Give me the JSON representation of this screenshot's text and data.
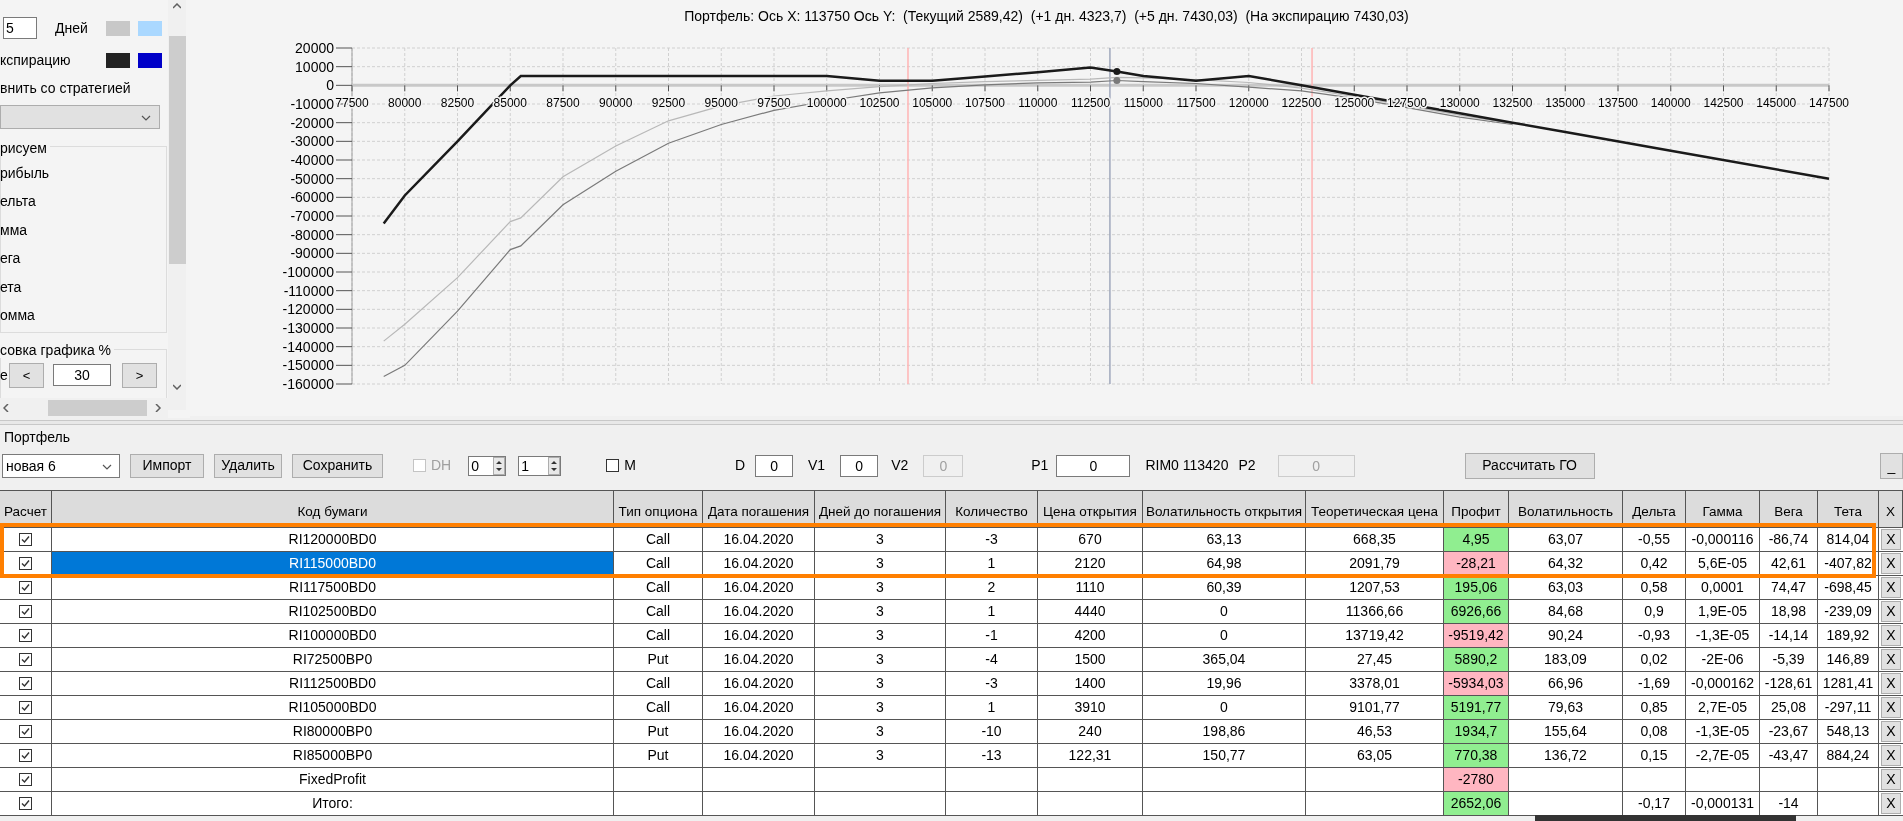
{
  "left_panel": {
    "rows": [
      {
        "value": "5",
        "label": "Дней",
        "swatches": [
          {
            "color": "#c8c8c8"
          },
          {
            "color": "#aad8ff"
          }
        ]
      },
      {
        "label": "кспирацию",
        "swatches": [
          {
            "color": "#222222"
          },
          {
            "color": "#0000c8"
          }
        ]
      }
    ],
    "compare_label": "внить со стратегией",
    "draw_group": {
      "title": "рисуем",
      "items": [
        "рибыль",
        "ельта",
        "мма",
        "ега",
        "ета",
        "омма"
      ]
    },
    "scale_group": {
      "title": "совка графика %",
      "label": "е",
      "prev": "<",
      "value": "30",
      "next": ">"
    }
  },
  "chart": {
    "title": "Портфель: Ось X: 113750 Ось Y:  (Текущий 2589,42)  (+1 дн. 4323,7)  (+5 дн. 7430,03)  (На экспирацию 7430,03)",
    "chart_data": {
      "type": "line",
      "x": [
        79000,
        80000,
        82500,
        85000,
        85500,
        87500,
        90000,
        92500,
        95000,
        97500,
        100000,
        102500,
        105000,
        107500,
        110000,
        112500,
        113750,
        115000,
        117500,
        120000,
        122500,
        125000,
        127500,
        130000,
        132500,
        135000,
        140000,
        147500
      ],
      "series": [
        {
          "color": "#7a7a7a",
          "values": [
            -156000,
            -150000,
            -121000,
            -88000,
            -86000,
            -64000,
            -46000,
            -31000,
            -21000,
            -13400,
            -8400,
            -4000,
            -1300,
            300,
            1300,
            1700,
            2600,
            2000,
            1000,
            -1000,
            -3000,
            -7000,
            -12000,
            -17000,
            -21000,
            null,
            null,
            null
          ]
        },
        {
          "color": "#b8b8b8",
          "values": [
            -137000,
            -128000,
            -103000,
            -73000,
            -71000,
            -49000,
            -32500,
            -19000,
            -11000,
            -5700,
            -3000,
            -700,
            1000,
            2000,
            2700,
            3300,
            4300,
            4000,
            3000,
            1500,
            -1500,
            -6000,
            -11000,
            -16000,
            -20500,
            null,
            null,
            null
          ]
        },
        {
          "color": "#1a1a1a",
          "values": [
            -74000,
            -59000,
            -30000,
            0,
            5000,
            5000,
            5000,
            5000,
            5000,
            5000,
            5000,
            2500,
            2500,
            4800,
            7000,
            9500,
            7400,
            5000,
            2500,
            5000,
            0,
            -5000,
            -10000,
            -15000,
            -20000,
            -25000,
            -35000,
            -50000
          ]
        }
      ],
      "xlim": [
        77500,
        147500
      ],
      "ylim": [
        -160000,
        20000
      ],
      "xticks": [
        77500,
        80000,
        82500,
        85000,
        87500,
        90000,
        92500,
        95000,
        97500,
        100000,
        102500,
        105000,
        107500,
        110000,
        112500,
        115000,
        117500,
        120000,
        122500,
        125000,
        127500,
        130000,
        132500,
        135000,
        137500,
        140000,
        142500,
        145000,
        147500
      ],
      "yticks": [
        20000,
        10000,
        0,
        -10000,
        -20000,
        -30000,
        -40000,
        -50000,
        -60000,
        -70000,
        -80000,
        -90000,
        -100000,
        -110000,
        -120000,
        -130000,
        -140000,
        -150000,
        -160000
      ],
      "grid": true,
      "ref_lines": [
        {
          "axis": "x",
          "value": 103850,
          "color": "#ffb4b4"
        },
        {
          "axis": "x",
          "value": 113420,
          "color": "#a0a8bc"
        },
        {
          "axis": "x",
          "value": 123000,
          "color": "#ffb4b4"
        }
      ]
    }
  },
  "portfolio": {
    "title": "Портфель",
    "strategy": "новая 6",
    "buttons": [
      "Импорт",
      "Удалить",
      "Сохранить"
    ],
    "dh": {
      "label": "DH",
      "checked": false,
      "disabled": true
    },
    "spinners": [
      "0",
      "1"
    ],
    "m": {
      "label": "M",
      "checked": false
    },
    "fields": [
      {
        "kind": "field",
        "label": "D",
        "value": "0",
        "disabled": false
      },
      {
        "kind": "field",
        "label": "V1",
        "value": "0",
        "disabled": false
      },
      {
        "kind": "field",
        "label": "V2",
        "value": "0",
        "disabled": true
      },
      {
        "kind": "field",
        "label": "P1",
        "value": "0",
        "disabled": false
      },
      {
        "kind": "text",
        "label": "RIM0 113420"
      },
      {
        "kind": "field",
        "label": "P2",
        "value": "0",
        "disabled": true
      }
    ],
    "calc_button": "Рассчитать ГО",
    "minimize_button": "_"
  },
  "table": {
    "columns": [
      "Расчет",
      "Код бумаги",
      "Тип опциона",
      "Дата погашения",
      "Дней до погашения",
      "Количество",
      "Цена открытия",
      "Волатильность открытия",
      "Теоретическая цена",
      "Профит",
      "Волатильность",
      "Дельта",
      "Гамма",
      "Вега",
      "Тета",
      "X"
    ],
    "rows": [
      {
        "checked": true,
        "selected": false,
        "code": "RI120000BD0",
        "type": "Call",
        "date": "16.04.2020",
        "days": "3",
        "qty": "-3",
        "open_price": "670",
        "open_vol": "63,13",
        "theo": "668,35",
        "profit": {
          "text": "4,95",
          "color": "#90ee90"
        },
        "vol": "63,07",
        "delta": "-0,55",
        "gamma": "-0,000116",
        "vega": "-86,74",
        "theta": "814,04",
        "remove": "X"
      },
      {
        "checked": true,
        "selected": true,
        "code": "RI115000BD0",
        "type": "Call",
        "date": "16.04.2020",
        "days": "3",
        "qty": "1",
        "open_price": "2120",
        "open_vol": "64,98",
        "theo": "2091,79",
        "profit": {
          "text": "-28,21",
          "color": "#ffb6c1"
        },
        "vol": "64,32",
        "delta": "0,42",
        "gamma": "5,6E-05",
        "vega": "42,61",
        "theta": "-407,82",
        "remove": "X"
      },
      {
        "checked": true,
        "selected": false,
        "code": "RI117500BD0",
        "type": "Call",
        "date": "16.04.2020",
        "days": "3",
        "qty": "2",
        "open_price": "1110",
        "open_vol": "60,39",
        "theo": "1207,53",
        "profit": {
          "text": "195,06",
          "color": "#90ee90"
        },
        "vol": "63,03",
        "delta": "0,58",
        "gamma": "0,0001",
        "vega": "74,47",
        "theta": "-698,45",
        "remove": "X"
      },
      {
        "checked": true,
        "selected": false,
        "code": "RI102500BD0",
        "type": "Call",
        "date": "16.04.2020",
        "days": "3",
        "qty": "1",
        "open_price": "4440",
        "open_vol": "0",
        "theo": "11366,66",
        "profit": {
          "text": "6926,66",
          "color": "#90ee90"
        },
        "vol": "84,68",
        "delta": "0,9",
        "gamma": "1,9E-05",
        "vega": "18,98",
        "theta": "-239,09",
        "remove": "X"
      },
      {
        "checked": true,
        "selected": false,
        "code": "RI100000BD0",
        "type": "Call",
        "date": "16.04.2020",
        "days": "3",
        "qty": "-1",
        "open_price": "4200",
        "open_vol": "0",
        "theo": "13719,42",
        "profit": {
          "text": "-9519,42",
          "color": "#ffb6c1"
        },
        "vol": "90,24",
        "delta": "-0,93",
        "gamma": "-1,3E-05",
        "vega": "-14,14",
        "theta": "189,92",
        "remove": "X"
      },
      {
        "checked": true,
        "selected": false,
        "code": "RI72500BP0",
        "type": "Put",
        "date": "16.04.2020",
        "days": "3",
        "qty": "-4",
        "open_price": "1500",
        "open_vol": "365,04",
        "theo": "27,45",
        "profit": {
          "text": "5890,2",
          "color": "#90ee90"
        },
        "vol": "183,09",
        "delta": "0,02",
        "gamma": "-2E-06",
        "vega": "-5,39",
        "theta": "146,89",
        "remove": "X"
      },
      {
        "checked": true,
        "selected": false,
        "code": "RI112500BD0",
        "type": "Call",
        "date": "16.04.2020",
        "days": "3",
        "qty": "-3",
        "open_price": "1400",
        "open_vol": "19,96",
        "theo": "3378,01",
        "profit": {
          "text": "-5934,03",
          "color": "#ffb6c1"
        },
        "vol": "66,96",
        "delta": "-1,69",
        "gamma": "-0,000162",
        "vega": "-128,61",
        "theta": "1281,41",
        "remove": "X"
      },
      {
        "checked": true,
        "selected": false,
        "code": "RI105000BD0",
        "type": "Call",
        "date": "16.04.2020",
        "days": "3",
        "qty": "1",
        "open_price": "3910",
        "open_vol": "0",
        "theo": "9101,77",
        "profit": {
          "text": "5191,77",
          "color": "#90ee90"
        },
        "vol": "79,63",
        "delta": "0,85",
        "gamma": "2,7E-05",
        "vega": "25,08",
        "theta": "-297,11",
        "remove": "X"
      },
      {
        "checked": true,
        "selected": false,
        "code": "RI80000BP0",
        "type": "Put",
        "date": "16.04.2020",
        "days": "3",
        "qty": "-10",
        "open_price": "240",
        "open_vol": "198,86",
        "theo": "46,53",
        "profit": {
          "text": "1934,7",
          "color": "#90ee90"
        },
        "vol": "155,64",
        "delta": "0,08",
        "gamma": "-1,3E-05",
        "vega": "-23,67",
        "theta": "548,13",
        "remove": "X"
      },
      {
        "checked": true,
        "selected": false,
        "code": "RI85000BP0",
        "type": "Put",
        "date": "16.04.2020",
        "days": "3",
        "qty": "-13",
        "open_price": "122,31",
        "open_vol": "150,77",
        "theo": "63,05",
        "profit": {
          "text": "770,38",
          "color": "#90ee90"
        },
        "vol": "136,72",
        "delta": "0,15",
        "gamma": "-2,7E-05",
        "vega": "-43,47",
        "theta": "884,24",
        "remove": "X"
      },
      {
        "checked": true,
        "selected": false,
        "code": "FixedProfit",
        "profit": {
          "text": "-2780",
          "color": "#ffb6c1"
        },
        "remove": "X"
      },
      {
        "checked": true,
        "selected": false,
        "code": "Итого:",
        "profit": {
          "text": "2652,06",
          "color": "#90ee90"
        },
        "delta": "-0,17",
        "gamma": "-0,000131",
        "vega": "-14",
        "remove": "X"
      }
    ]
  }
}
